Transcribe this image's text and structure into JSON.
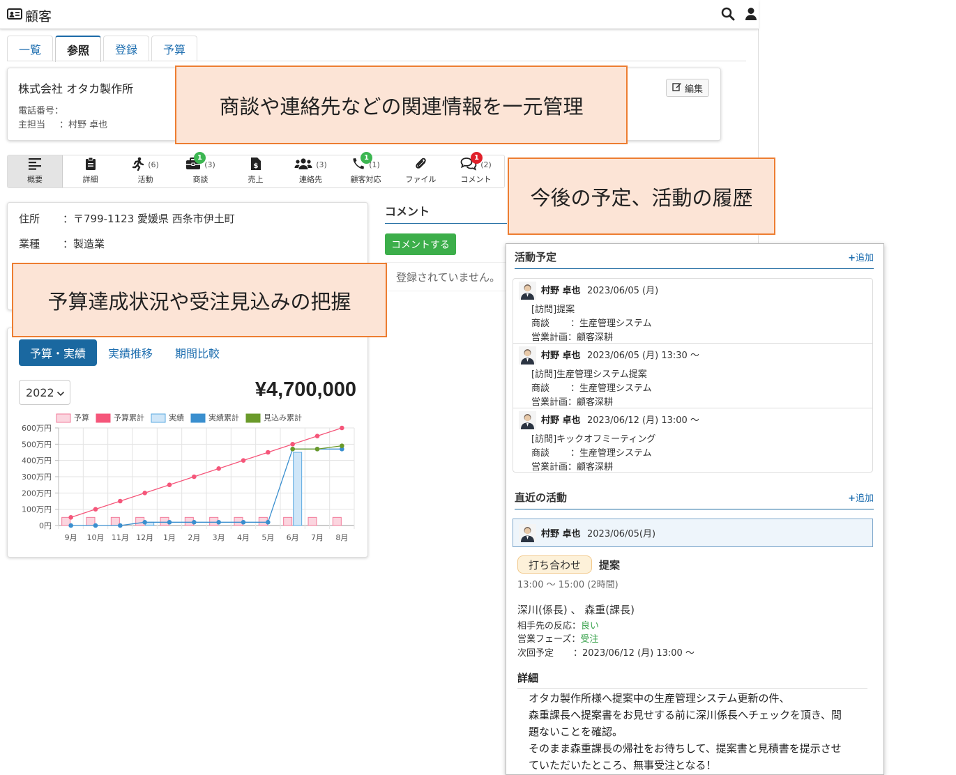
{
  "header": {
    "title": "顧客",
    "icons": [
      "id-card-icon",
      "search-icon",
      "user-icon"
    ]
  },
  "tabs": [
    {
      "label": "一覧",
      "active": false
    },
    {
      "label": "参照",
      "active": true
    },
    {
      "label": "登録",
      "active": false
    },
    {
      "label": "予算",
      "active": false
    }
  ],
  "customer": {
    "name": "株式会社 オタカ製作所",
    "phone_label": "電話番号：",
    "owner_label": "主担当",
    "owner_value": "：村野 卓也",
    "edit_label": "編集"
  },
  "iconbar": [
    {
      "label": "概要",
      "icon": "list-icon",
      "count": "",
      "badge": ""
    },
    {
      "label": "詳細",
      "icon": "clipboard-icon",
      "count": "",
      "badge": ""
    },
    {
      "label": "活動",
      "icon": "running-icon",
      "count": "(6)",
      "badge": ""
    },
    {
      "label": "商談",
      "icon": "briefcase-icon",
      "count": "(3)",
      "badge": "1"
    },
    {
      "label": "売上",
      "icon": "invoice-icon",
      "count": "",
      "badge": ""
    },
    {
      "label": "連絡先",
      "icon": "users-icon",
      "count": "(3)",
      "badge": ""
    },
    {
      "label": "顧客対応",
      "icon": "phone-icon",
      "count": "(1)",
      "badge": "1"
    },
    {
      "label": "ファイル",
      "icon": "paperclip-icon",
      "count": "",
      "badge": ""
    },
    {
      "label": "コメント",
      "icon": "comments-icon",
      "count": "(2)",
      "badge": "1"
    }
  ],
  "address": {
    "address_label": "住所",
    "address_value": "：〒799-1123 愛媛県 西条市伊土町",
    "industry_label": "業種",
    "industry_value": "：製造業"
  },
  "budget": {
    "tabs": [
      "予算・実績",
      "実績推移",
      "期間比較"
    ],
    "year": "2022",
    "amount": "¥4,700,000"
  },
  "chart_data": {
    "type": "bar",
    "categories": [
      "9月",
      "10月",
      "11月",
      "12月",
      "1月",
      "2月",
      "3月",
      "4月",
      "5月",
      "6月",
      "7月",
      "8月"
    ],
    "ylim": [
      0,
      600
    ],
    "yticks": [
      "0円",
      "100万円",
      "200万円",
      "300万円",
      "400万円",
      "500万円",
      "600万円"
    ],
    "grid": true,
    "legend_position": "top",
    "series": [
      {
        "name": "予算",
        "kind": "bar",
        "color": "#fbd5df",
        "stroke": "#f27a9a",
        "values": [
          50,
          50,
          50,
          50,
          50,
          50,
          50,
          50,
          50,
          50,
          50,
          50
        ]
      },
      {
        "name": "予算累計",
        "kind": "line",
        "color": "#f5567a",
        "values": [
          50,
          100,
          150,
          200,
          250,
          300,
          350,
          400,
          450,
          500,
          550,
          600
        ]
      },
      {
        "name": "実績",
        "kind": "bar",
        "color": "#cfe6f8",
        "stroke": "#5aa9e0",
        "values": [
          0,
          0,
          0,
          20,
          0,
          0,
          0,
          0,
          0,
          450,
          0,
          0
        ]
      },
      {
        "name": "実績累計",
        "kind": "line",
        "color": "#3a8fcf",
        "values": [
          0,
          0,
          0,
          20,
          20,
          20,
          20,
          20,
          20,
          470,
          470,
          470
        ]
      },
      {
        "name": "見込み累計",
        "kind": "line",
        "color": "#6a9a2a",
        "values": [
          null,
          null,
          null,
          null,
          null,
          null,
          null,
          null,
          null,
          470,
          470,
          490
        ]
      }
    ]
  },
  "comment": {
    "title": "コメント",
    "button": "コメントする",
    "empty": "登録されていません。"
  },
  "callouts": {
    "c1": "商談や連絡先などの関連情報を一元管理",
    "c2": "今後の予定、活動の履歴",
    "c3": "予算達成状況や受注見込みの把握"
  },
  "schedule": {
    "title": "活動予定",
    "add_label": "追加",
    "items": [
      {
        "name": "村野 卓也",
        "date": "2023/06/05 (月)",
        "subject": "[訪問]提案",
        "deal_label": "商談",
        "deal_value": "：生産管理システム",
        "plan_label": "営業計画",
        "plan_value": "：顧客深耕"
      },
      {
        "name": "村野 卓也",
        "date": "2023/06/05 (月) 13:30 ～",
        "subject": "[訪問]生産管理システム提案",
        "deal_label": "商談",
        "deal_value": "：生産管理システム",
        "plan_label": "営業計画",
        "plan_value": "：顧客深耕"
      },
      {
        "name": "村野 卓也",
        "date": "2023/06/12 (月) 13:00 ～",
        "subject": "[訪問]キックオフミーティング",
        "deal_label": "商談",
        "deal_value": "：生産管理システム",
        "plan_label": "営業計画",
        "plan_value": "：顧客深耕"
      }
    ]
  },
  "recent": {
    "title": "直近の活動",
    "add_label": "追加",
    "name": "村野 卓也",
    "date": "2023/06/05(月)",
    "type_chip": "打ち合わせ",
    "subject": "提案",
    "time": "13:00 ～ 15:00 (2時間)",
    "attendees": "深川(係長) 、 森重(課長)",
    "reaction_label": "相手先の反応：",
    "reaction_value": "良い",
    "phase_label": "営業フェーズ：",
    "phase_value": "受注",
    "next_label": "次回予定",
    "next_value": "：2023/06/12 (月) 13:00 ～",
    "detail_title": "詳細",
    "detail_lines": [
      "オタカ製作所様へ提案中の生産管理システム更新の件、",
      "森重課長へ提案書をお見せする前に深川係長へチェックを頂き、問",
      "題ないことを確認。",
      "そのまま森重課長の帰社をお待ちして、提案書と見積書を提示させ",
      "ていただいたところ、無事受注となる！"
    ]
  }
}
